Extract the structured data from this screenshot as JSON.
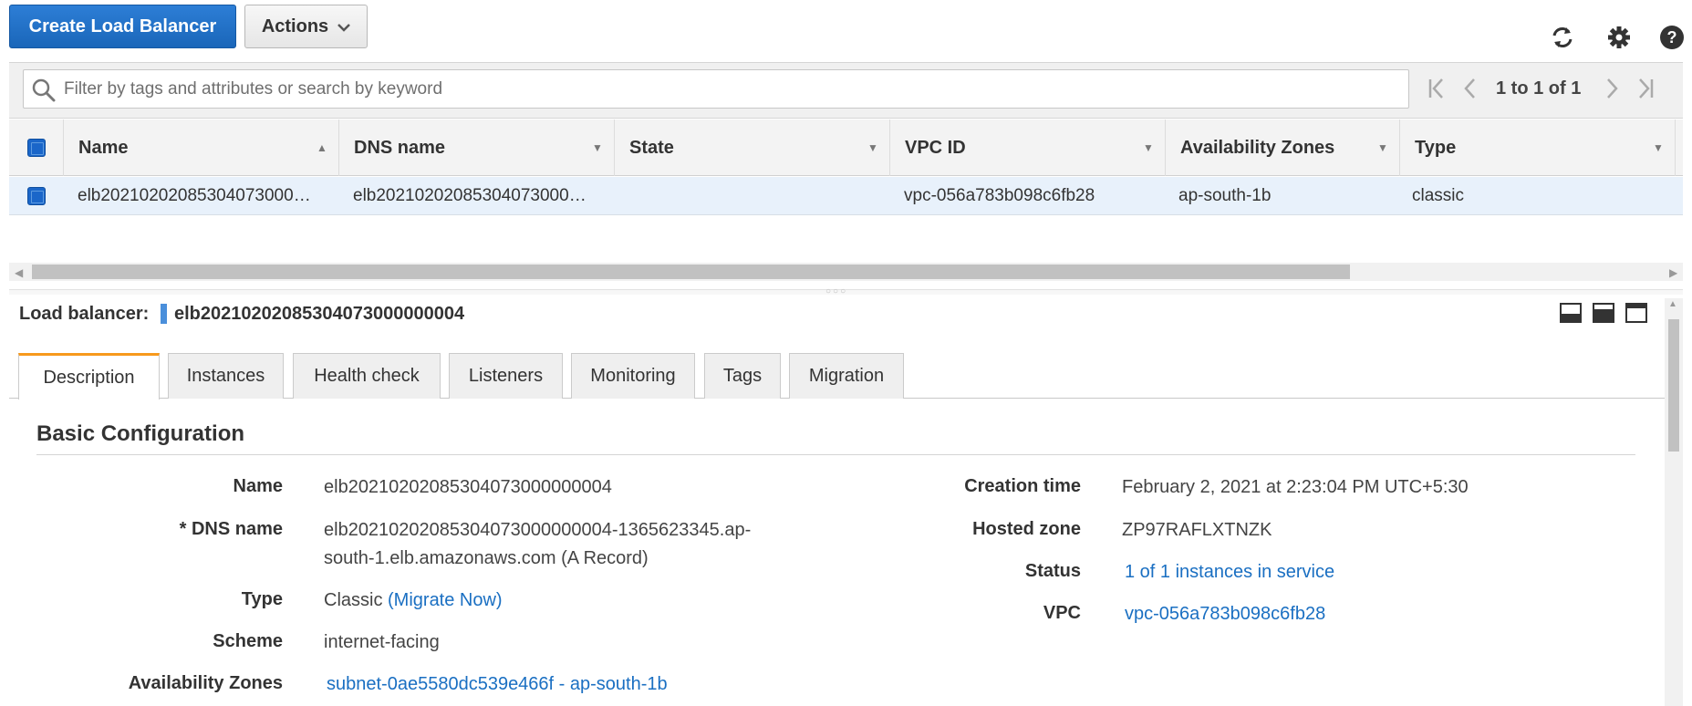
{
  "toolbar": {
    "create_label": "Create Load Balancer",
    "actions_label": "Actions",
    "refresh_icon": "refresh-icon",
    "settings_icon": "gear-icon",
    "help_icon": "help-icon"
  },
  "filter": {
    "placeholder": "Filter by tags and attributes or search by keyword",
    "pagination": "1 to 1 of 1"
  },
  "table": {
    "columns": [
      "Name",
      "DNS name",
      "State",
      "VPC ID",
      "Availability Zones",
      "Type"
    ],
    "rows": [
      {
        "selected": true,
        "name": "elb20210202085304073000…",
        "dns_name": "elb20210202085304073000…",
        "state": "",
        "vpc_id": "vpc-056a783b098c6fb28",
        "availability_zones": "ap-south-1b",
        "type": "classic"
      }
    ]
  },
  "detail": {
    "label": "Load balancer:",
    "name": "elb20210202085304073000000004",
    "tabs": [
      "Description",
      "Instances",
      "Health check",
      "Listeners",
      "Monitoring",
      "Tags",
      "Migration"
    ],
    "active_tab": "Description",
    "section_title": "Basic Configuration",
    "left_fields": {
      "name_label": "Name",
      "name_value": "elb20210202085304073000000004",
      "dns_label": "* DNS name",
      "dns_value_line1": "elb20210202085304073000000004-1365623345.ap-",
      "dns_value_line2": "south-1.elb.amazonaws.com (A Record)",
      "type_label": "Type",
      "type_value": "Classic",
      "type_link": "(Migrate Now)",
      "scheme_label": "Scheme",
      "scheme_value": "internet-facing",
      "az_label": "Availability Zones",
      "az_value": "subnet-0ae5580dc539e466f - ap-south-1b"
    },
    "right_fields": {
      "creation_label": "Creation time",
      "creation_value": "February 2, 2021 at 2:23:04 PM UTC+5:30",
      "hosted_zone_label": "Hosted zone",
      "hosted_zone_value": "ZP97RAFLXTNZK",
      "status_label": "Status",
      "status_value": "1 of 1 instances in service",
      "vpc_label": "VPC",
      "vpc_value": "vpc-056a783b098c6fb28"
    }
  },
  "colors": {
    "primary": "#1a66b9",
    "link": "#1a6fc2",
    "active_tab_accent": "#f7991c",
    "selected_row": "#e8f1fb"
  }
}
